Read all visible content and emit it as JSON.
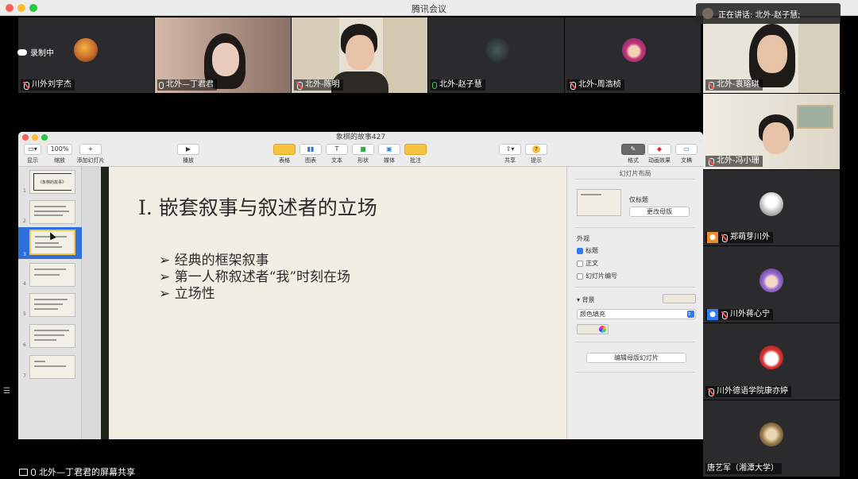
{
  "app_title": "腾讯会议",
  "recording_label": "录制中",
  "speaker_banner": "正在讲话: 北外-赵子慧;",
  "top_tiles": [
    {
      "name": "川外刘宇杰"
    },
    {
      "name": "北外—丁君君"
    },
    {
      "name": "北外-陈明"
    },
    {
      "name": "北外-赵子慧"
    },
    {
      "name": "北外-周浩桢"
    },
    {
      "name": "北外-袁珞琪"
    }
  ],
  "right_tiles": [
    {
      "name": "北外-冯小珊"
    },
    {
      "name": "郑萌芽川外"
    },
    {
      "name": "川外蒋心宁"
    },
    {
      "name": "川外德语学院康亦婷"
    },
    {
      "name": "唐艺军（湘潭大学）"
    }
  ],
  "share_label": "北外—丁君君的屏幕共享",
  "keynote": {
    "title": "象棋的故事427",
    "toolbar": {
      "view": "显示",
      "zoom": "缩放",
      "zoom_value": "100%",
      "add_slide": "添加幻灯片",
      "play": "播放",
      "table": "表格",
      "chart": "图表",
      "text": "文本",
      "shape": "形状",
      "media": "媒体",
      "comment": "批注",
      "share": "共享",
      "tips": "提示",
      "format": "格式",
      "animate": "动画效果",
      "document": "文稿"
    },
    "slide_numbers": [
      "1",
      "2",
      "3",
      "4",
      "5",
      "6",
      "7"
    ],
    "selected_slide": 3,
    "thumb_title": "《象棋的故事》",
    "slide": {
      "title": "I. 嵌套叙事与叙述者的立场",
      "bullets": [
        "➢ 经典的框架叙事",
        "➢ 第一人称叙述者“我”时刻在场",
        "➢ 立场性"
      ]
    },
    "inspector": {
      "header": "幻灯片布局",
      "layout_name": "仅标题",
      "change_master": "更改母版",
      "appearance": "外观",
      "cb_title": "标题",
      "cb_body": "正文",
      "cb_number": "幻灯片编号",
      "background": "背景",
      "fill": "颜色填充",
      "edit_master": "编辑母版幻灯片"
    }
  },
  "colors": {
    "accent": "#2f6fdb",
    "speaking": "#3ad15a",
    "mute": "#ff4d4f"
  }
}
